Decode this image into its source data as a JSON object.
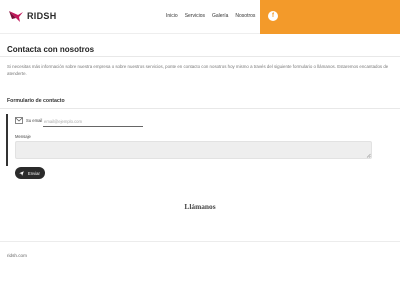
{
  "brand": {
    "name": "RIDSH",
    "logo_color": "#c2185b"
  },
  "nav": {
    "items": [
      "Inicio",
      "Servicios",
      "Galería",
      "Nosotros"
    ]
  },
  "header": {
    "accent": "#f39a2a",
    "social_icon": "facebook-icon",
    "social_glyph": "f"
  },
  "page": {
    "title": "Contacta con nosotros",
    "intro": "Si necesitas más información sobre nuestra empresa o sobre nuestros servicios, ponte en contacto con nosotros hoy mismo a través del siguiente formulario o llámanos. Estaremos encantados de atenderte."
  },
  "form": {
    "title": "Formulario de contacto",
    "email_label": "Su email",
    "email_placeholder": "email@ejemplo.com",
    "email_value": "",
    "message_label": "Mensaje",
    "message_value": "",
    "send_label": "Enviar"
  },
  "call": {
    "heading": "Llámanos"
  },
  "footer": {
    "text": "ridsh.com"
  }
}
